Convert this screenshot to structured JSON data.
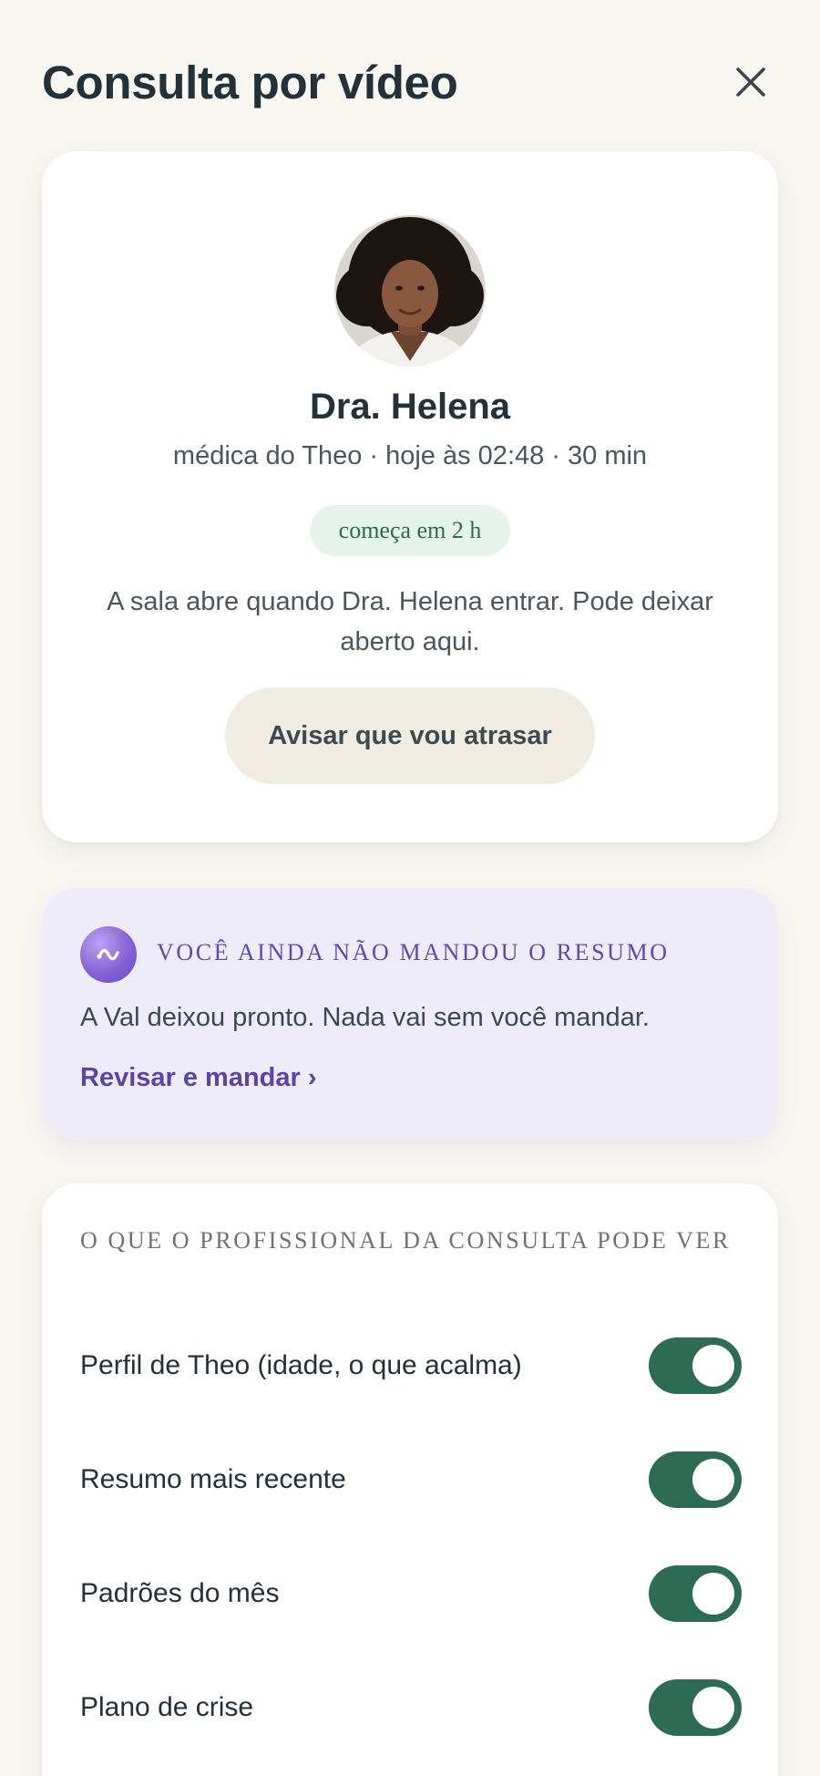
{
  "header": {
    "title": "Consulta por vídeo",
    "close_icon": "close-icon"
  },
  "doctor": {
    "avatar_icon": "avatar",
    "name": "Dra. Helena",
    "meta": "médica do Theo · hoje às 02:48 · 30 min",
    "status": "começa em 2 h",
    "room_info": "A sala abre quando Dra. Helena entrar. Pode deixar aberto aqui.",
    "late_button": "Avisar que vou atrasar"
  },
  "summary": {
    "icon": "val-assistant-icon",
    "eyebrow": "VOCÊ AINDA NÃO MANDOU O RESUMO",
    "text": "A Val deixou pronto. Nada vai sem você mandar.",
    "link": "Revisar e mandar ›"
  },
  "permissions": {
    "eyebrow": "O QUE O PROFISSIONAL DA CONSULTA PODE VER",
    "items": [
      {
        "label": "Perfil de Theo (idade, o que acalma)",
        "enabled": true
      },
      {
        "label": "Resumo mais recente",
        "enabled": true
      },
      {
        "label": "Padrões do mês",
        "enabled": true
      },
      {
        "label": "Plano de crise",
        "enabled": true
      }
    ],
    "footer": ""
  },
  "colors": {
    "background": "#f8f6f1",
    "toggle_on": "#2e6b55",
    "accent_purple": "#5c43ab",
    "status_pill_bg": "#e6f2ec"
  }
}
